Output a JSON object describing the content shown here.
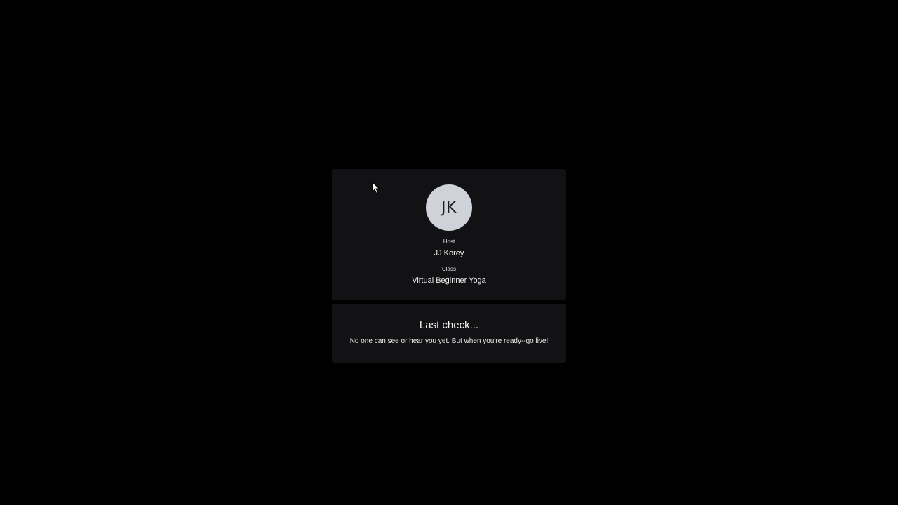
{
  "host_card": {
    "avatar_initials": "JK",
    "host_label": "Host",
    "host_name": "JJ Korey",
    "class_label": "Class",
    "class_name": "Virtual Beginner Yoga"
  },
  "check_card": {
    "title": "Last check...",
    "description": "No one can see or hear you yet. But when you're ready--go live!"
  },
  "colors": {
    "background": "#000000",
    "card": "#121214",
    "avatar": "#cfd3d9"
  }
}
